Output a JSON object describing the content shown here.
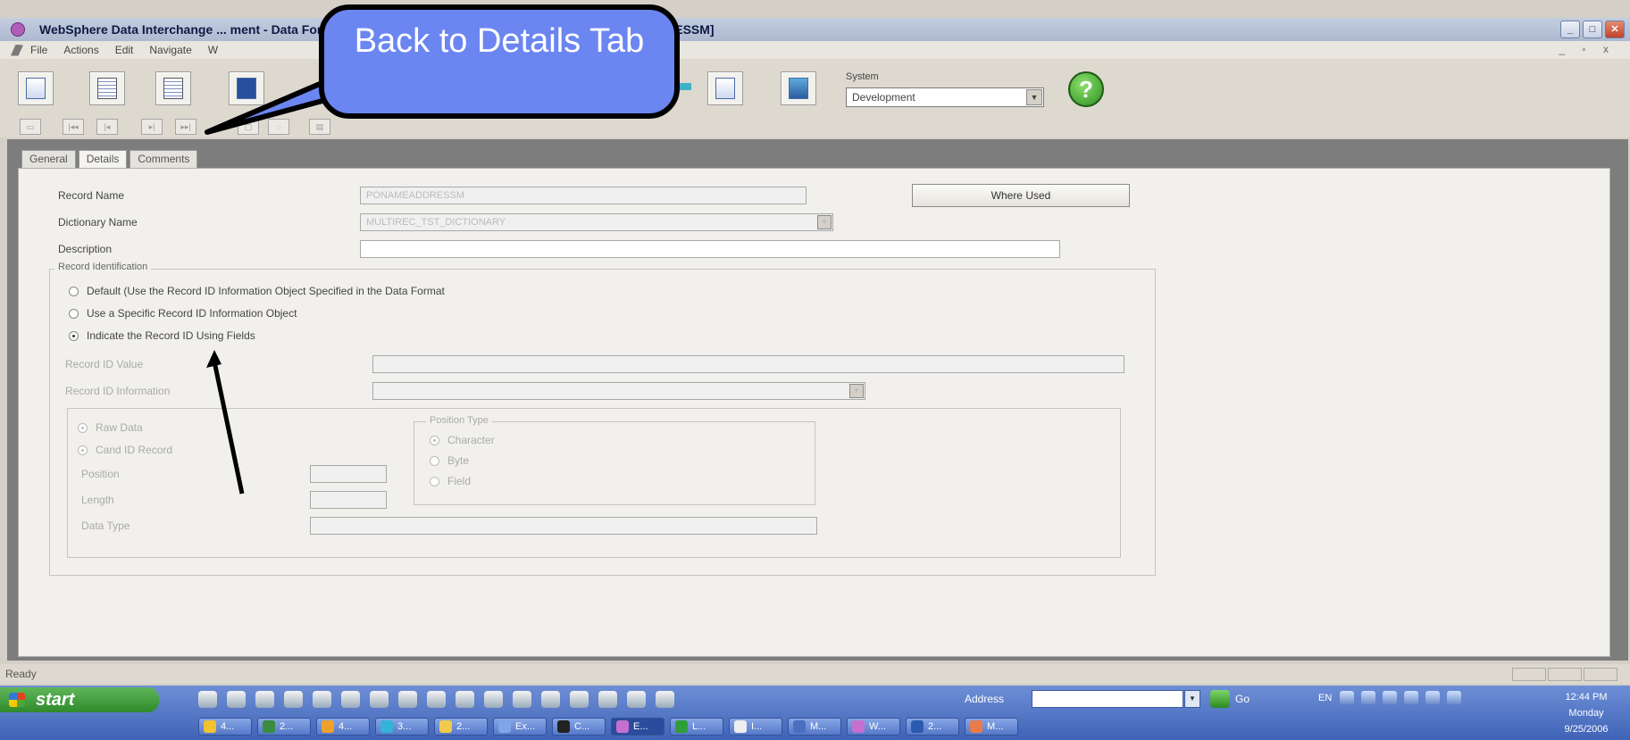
{
  "window": {
    "title": "WebSphere Data Interchange ... ment - Data Format Record - MULTIREC_TST_DICTIONARY  PONAMEADDRESSM]",
    "min": "_",
    "max": "□",
    "close": "✕"
  },
  "menu": {
    "items": [
      "File",
      "Actions",
      "Edit",
      "Navigate",
      "W"
    ],
    "mdi_controls": "_ ▫ x"
  },
  "toolbar": {
    "system_label": "System",
    "system_value": "Development",
    "help_glyph": "?"
  },
  "navigation": {
    "first": "|◂◂",
    "prev": "|◂",
    "next": "▸|",
    "last": "▸▸|"
  },
  "callout": {
    "text": "Back to Details Tab"
  },
  "tabs": [
    "General",
    "Details",
    "Comments"
  ],
  "form": {
    "record_name_label": "Record Name",
    "record_name_value": "PONAMEADDRESSM",
    "dictionary_name_label": "Dictionary Name",
    "dictionary_name_value": "MULTIREC_TST_DICTIONARY",
    "description_label": "Description",
    "description_value": "",
    "where_used_label": "Where Used",
    "record_identification_label": "Record Identification",
    "radio_options": [
      "Default (Use the Record ID Information Object Specified in the Data Format",
      "Use a Specific Record ID Information Object",
      "Indicate the Record ID Using Fields"
    ],
    "selected_radio_index": 2,
    "record_id_value_label": "Record ID Value",
    "record_id_info_label": "Record ID Information",
    "raw_data_label": "Raw Data",
    "cand_record_label": "Cand ID Record",
    "position_label": "Position",
    "length_label": "Length",
    "data_type_label": "Data Type",
    "position_type_label": "Position Type",
    "position_type_options": [
      "Character",
      "Byte",
      "Field"
    ]
  },
  "status": {
    "text": "Ready"
  },
  "taskbar": {
    "start_label": "start",
    "address_label": "Address",
    "go_label": "Go",
    "lang": "EN",
    "clock_time": "12:44 PM",
    "clock_day": "Monday",
    "clock_date": "9/25/2006",
    "tasks": [
      "4...",
      "2...",
      "4...",
      "3...",
      "2...",
      "Ex...",
      "C...",
      "E...",
      "L...",
      "I...",
      "M...",
      "W...",
      "2...",
      "M..."
    ]
  },
  "colors": {
    "callout_fill": "#6b86f1",
    "workspace": "#7d7d7d",
    "taskbar": "#3f63b6",
    "start": "#2f8a2b"
  }
}
